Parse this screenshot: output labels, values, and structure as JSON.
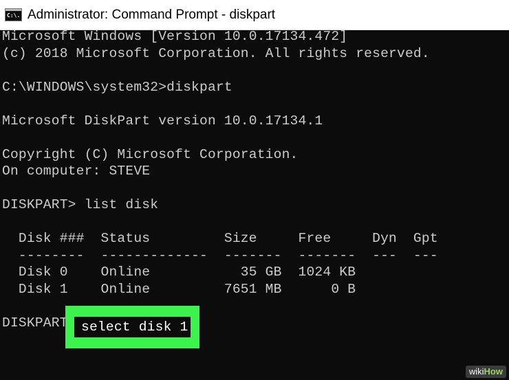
{
  "window": {
    "title": "Administrator: Command Prompt - diskpart",
    "icon": "command-prompt-icon",
    "icon_glyph": "C:\\."
  },
  "console": {
    "lines": [
      "Microsoft Windows [Version 10.0.17134.472]",
      "(c) 2018 Microsoft Corporation. All rights reserved.",
      "",
      "C:\\WINDOWS\\system32>diskpart",
      "",
      "Microsoft DiskPart version 10.0.17134.1",
      "",
      "Copyright (C) Microsoft Corporation.",
      "On computer: STEVE",
      "",
      "DISKPART> list disk",
      "",
      "  Disk ###  Status         Size     Free     Dyn  Gpt",
      "  --------  -------------  -------  -------  ---  ---",
      "  Disk 0    Online           35 GB  1024 KB",
      "  Disk 1    Online         7651 MB      0 B",
      "",
      "DISKPART"
    ],
    "current_input": "select disk 1",
    "highlight_color": "#3cf24c",
    "text_color": "#cccccc",
    "background_color": "#0c0c0c"
  },
  "watermark": {
    "prefix": "wiki",
    "suffix": "How"
  }
}
